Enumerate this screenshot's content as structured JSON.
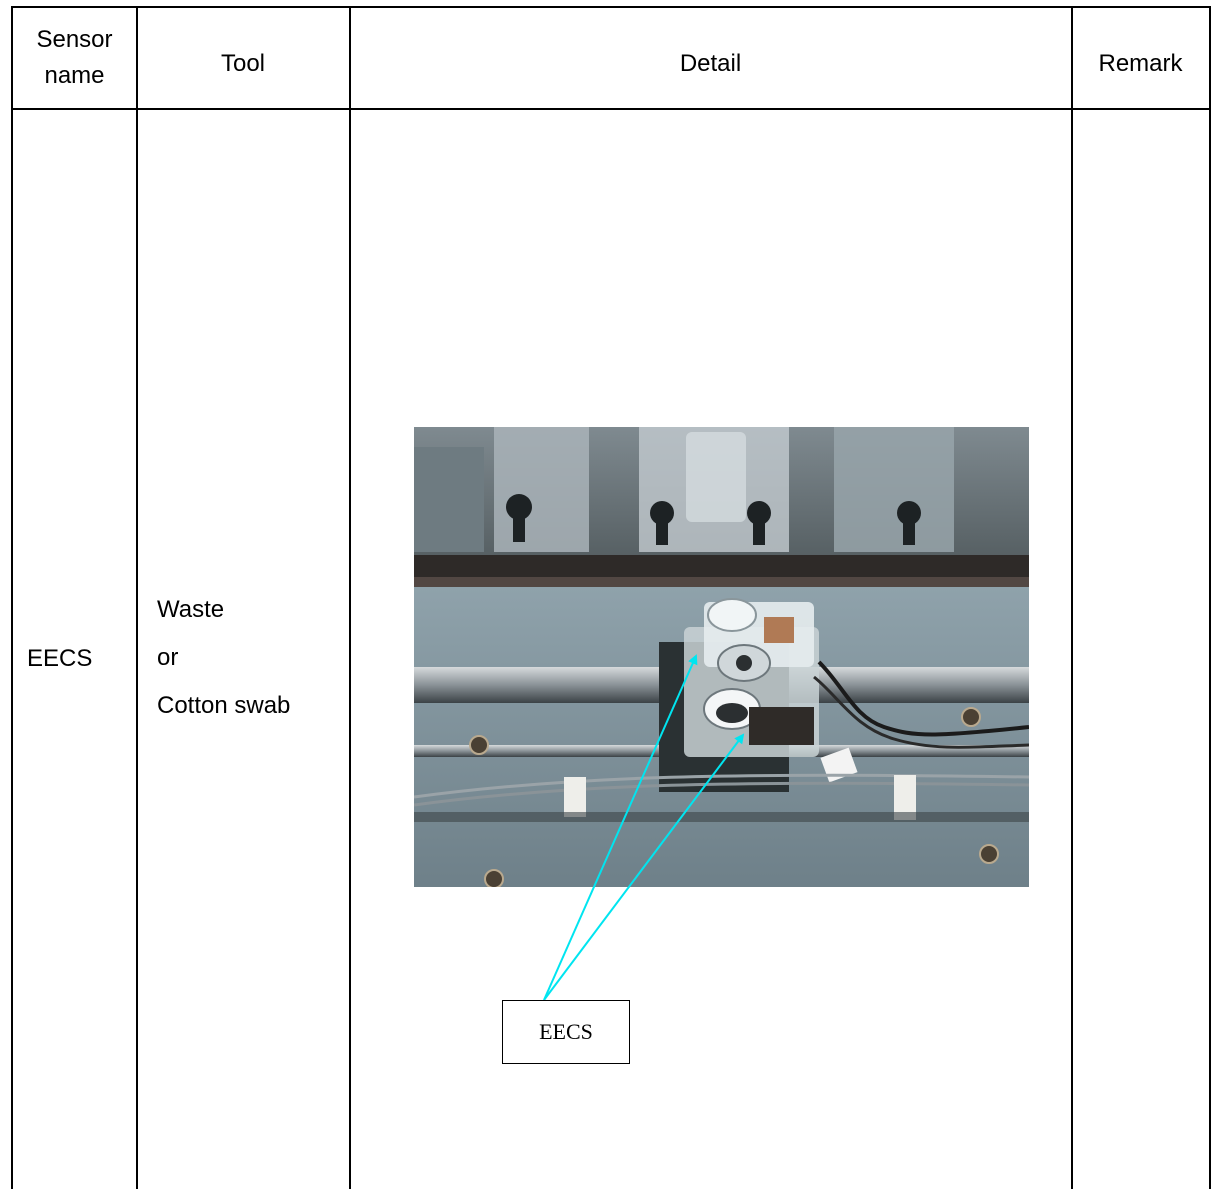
{
  "table": {
    "headers": {
      "sensor_name": "Sensor\nname",
      "tool": "Tool",
      "detail": "Detail",
      "remark": "Remark"
    },
    "row": {
      "sensor_name": "EECS",
      "tool_lines": [
        "Waste",
        "or",
        "Cotton swab"
      ],
      "remark": ""
    }
  },
  "figure": {
    "photo": "photo",
    "callout_label": "EECS",
    "arrow_color": "#00e5f0"
  }
}
